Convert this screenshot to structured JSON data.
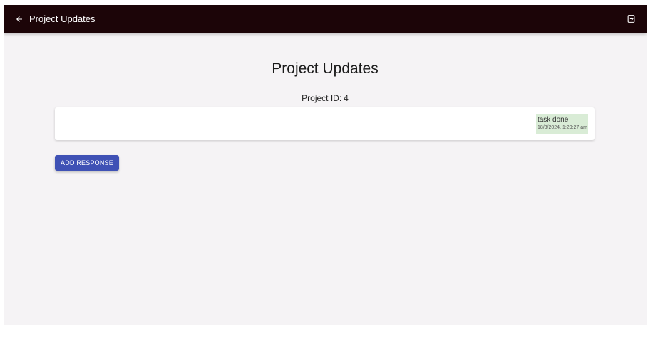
{
  "appbar": {
    "title": "Project Updates",
    "back_icon": "arrow-left-icon",
    "logout_icon": "logout-icon",
    "background": "#1c0508"
  },
  "main": {
    "page_title": "Project Updates",
    "project_id_label": "Project ID:",
    "project_id_value": "4"
  },
  "updates": [
    {
      "text": "task done",
      "timestamp": "18/3/2024, 1:29:27 am",
      "bubble_color": "#d9ecd6"
    }
  ],
  "actions": {
    "add_response_label": "ADD RESPONSE",
    "accent": "#3f51b5"
  }
}
